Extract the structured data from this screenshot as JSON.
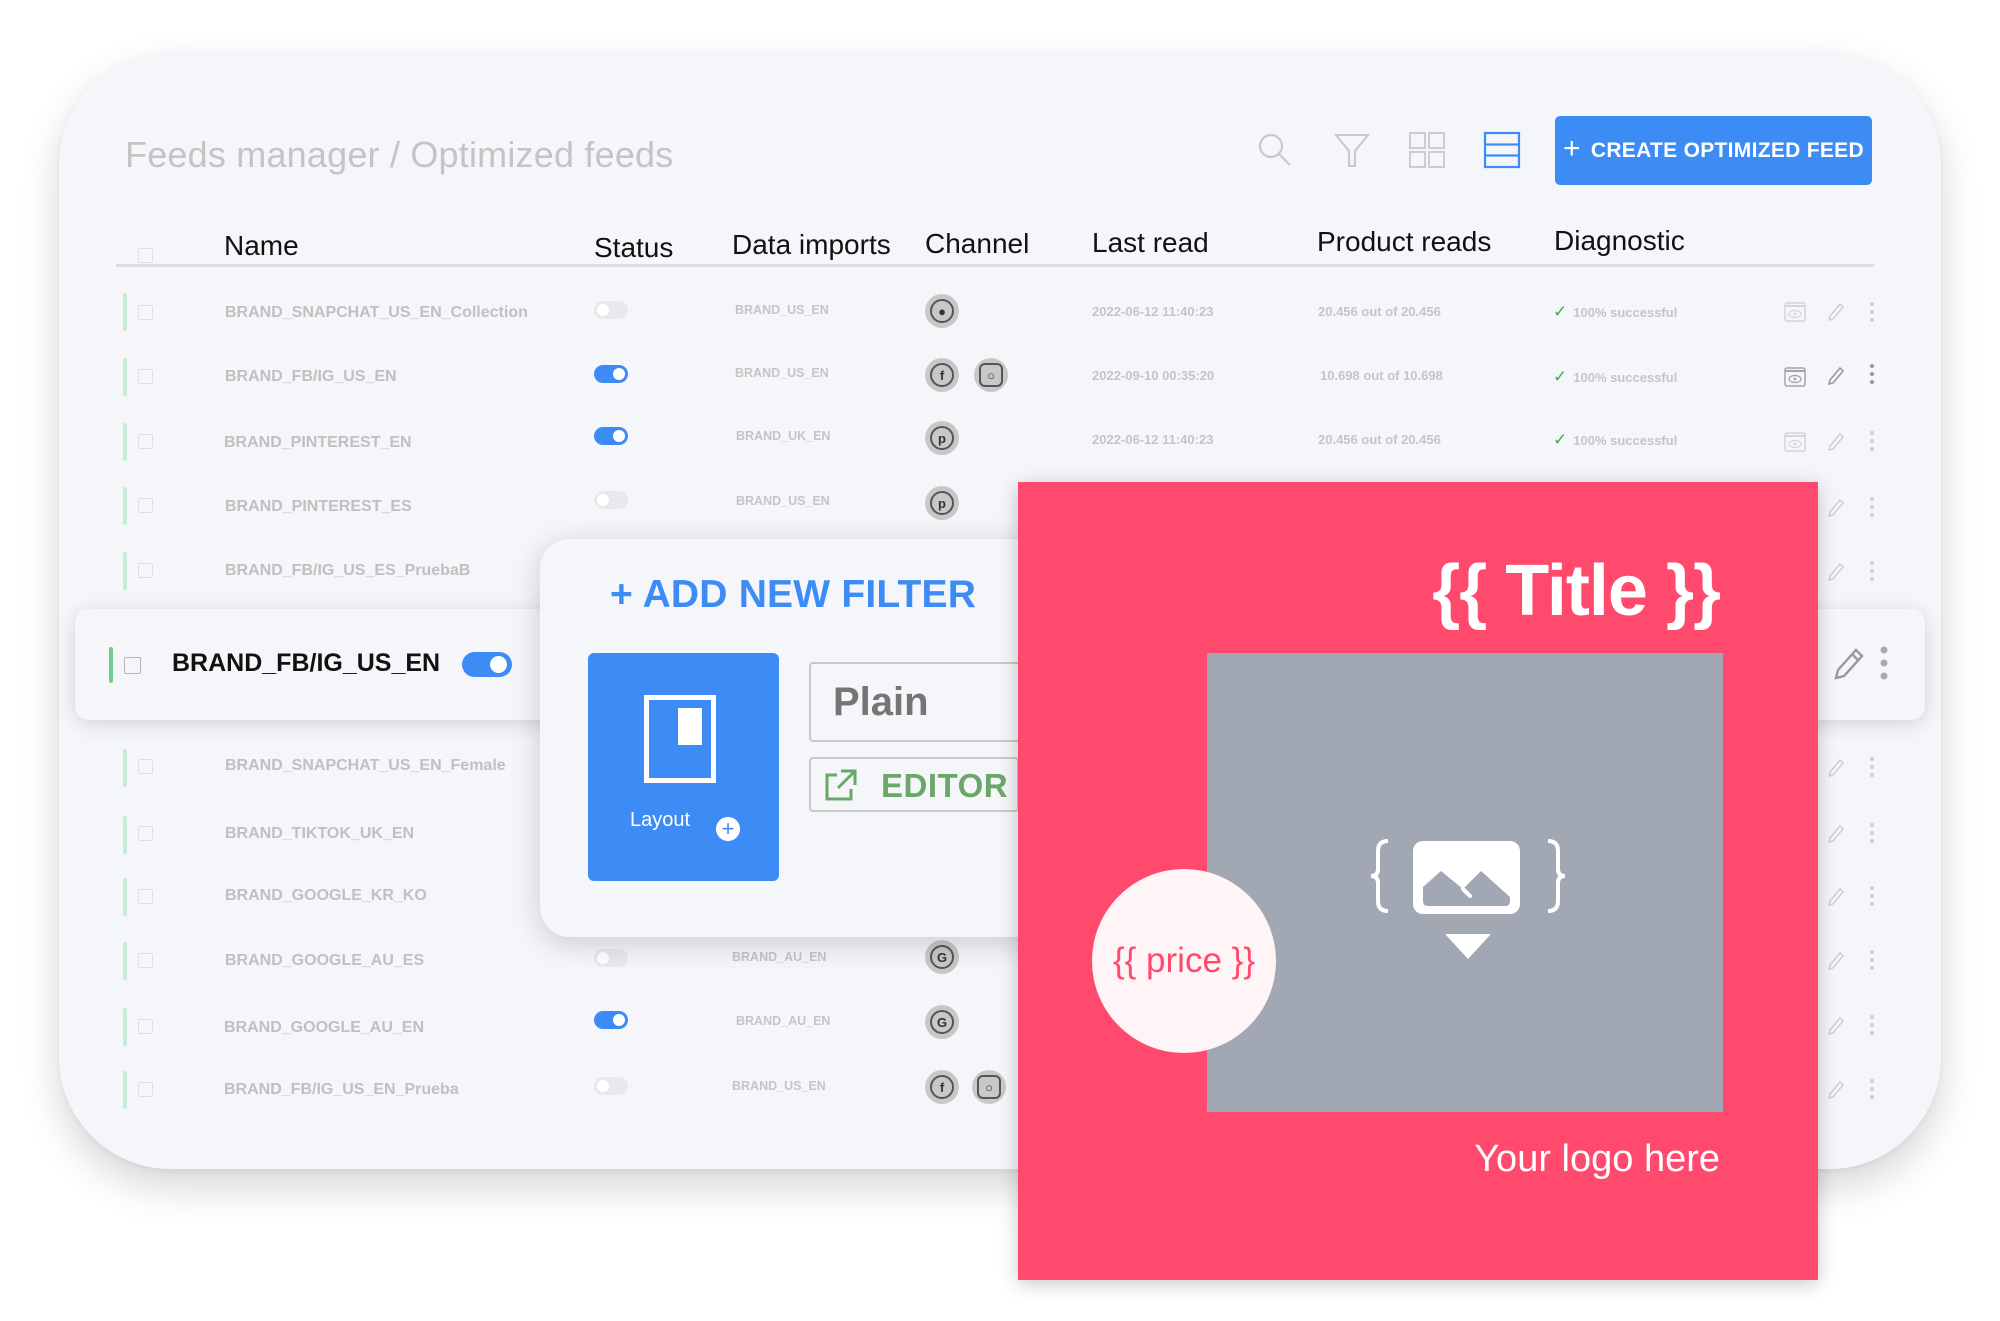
{
  "header": {
    "breadcrumb": "Feeds manager / Optimized feeds",
    "toolbar": {
      "icons": [
        "search-icon",
        "filter-icon",
        "grid-view-icon",
        "list-view-icon"
      ],
      "active_view": "list",
      "create_button": "CREATE OPTIMIZED FEED",
      "create_button_icon": "+"
    }
  },
  "table": {
    "columns": [
      "Name",
      "Status",
      "Data imports",
      "Channel",
      "Last read",
      "Product reads",
      "Diagnostic"
    ],
    "rows": [
      {
        "name": "BRAND_SNAPCHAT_US_EN_Collection",
        "status_on": false,
        "data_import": "BRAND_US_EN",
        "channels": [
          "snapchat"
        ],
        "last_read": "2022-06-12  11:40:23",
        "product_reads": "20.456 out of 20.456",
        "diagnostic": "100% successful"
      },
      {
        "name": "BRAND_FB/IG_US_EN",
        "status_on": true,
        "data_import": "BRAND_US_EN",
        "channels": [
          "facebook",
          "instagram"
        ],
        "last_read": "2022-09-10  00:35:20",
        "product_reads": "10.698 out of 10.698",
        "diagnostic": "100% successful"
      },
      {
        "name": "BRAND_PINTEREST_EN",
        "status_on": true,
        "data_import": "BRAND_UK_EN",
        "channels": [
          "pinterest"
        ],
        "last_read": "2022-06-12  11:40:23",
        "product_reads": "20.456 out of 20.456",
        "diagnostic": "100% successful"
      },
      {
        "name": "BRAND_PINTEREST_ES",
        "status_on": false,
        "data_import": "BRAND_US_EN",
        "channels": [
          "pinterest"
        ]
      },
      {
        "name": "BRAND_FB/IG_US_ES_PruebaB",
        "status_on": false
      },
      {
        "name": "BRAND_SNAPCHAT_US_EN_Female"
      },
      {
        "name": "BRAND_TIKTOK_UK_EN"
      },
      {
        "name": "BRAND_GOOGLE_KR_KO"
      },
      {
        "name": "BRAND_GOOGLE_AU_ES",
        "status_on": false,
        "data_import": "BRAND_AU_EN",
        "channels": [
          "google"
        ]
      },
      {
        "name": "BRAND_GOOGLE_AU_EN",
        "status_on": true,
        "data_import": "BRAND_AU_EN",
        "channels": [
          "google"
        ]
      },
      {
        "name": "BRAND_FB/IG_US_EN_Prueba",
        "status_on": false,
        "data_import": "BRAND_US_EN",
        "channels": [
          "facebook",
          "instagram"
        ]
      }
    ],
    "highlighted_row": {
      "name": "BRAND_FB/IG_US_EN",
      "status_on": true
    }
  },
  "filter_panel": {
    "title": "+ ADD NEW FILTER",
    "layout_button": "Layout",
    "layout_value": "Plain",
    "editor_button": "EDITOR"
  },
  "template_preview": {
    "title": "{{ Title }}",
    "price": "{{ price }}",
    "logo_text": "Your logo here",
    "image_placeholder": "{ image }",
    "background_color": "#ff4a6e",
    "image_color": "#a1a8b4"
  },
  "colors": {
    "accent": "#3d8cf5",
    "success": "#4aa85a",
    "editor": "#6aa86a"
  }
}
